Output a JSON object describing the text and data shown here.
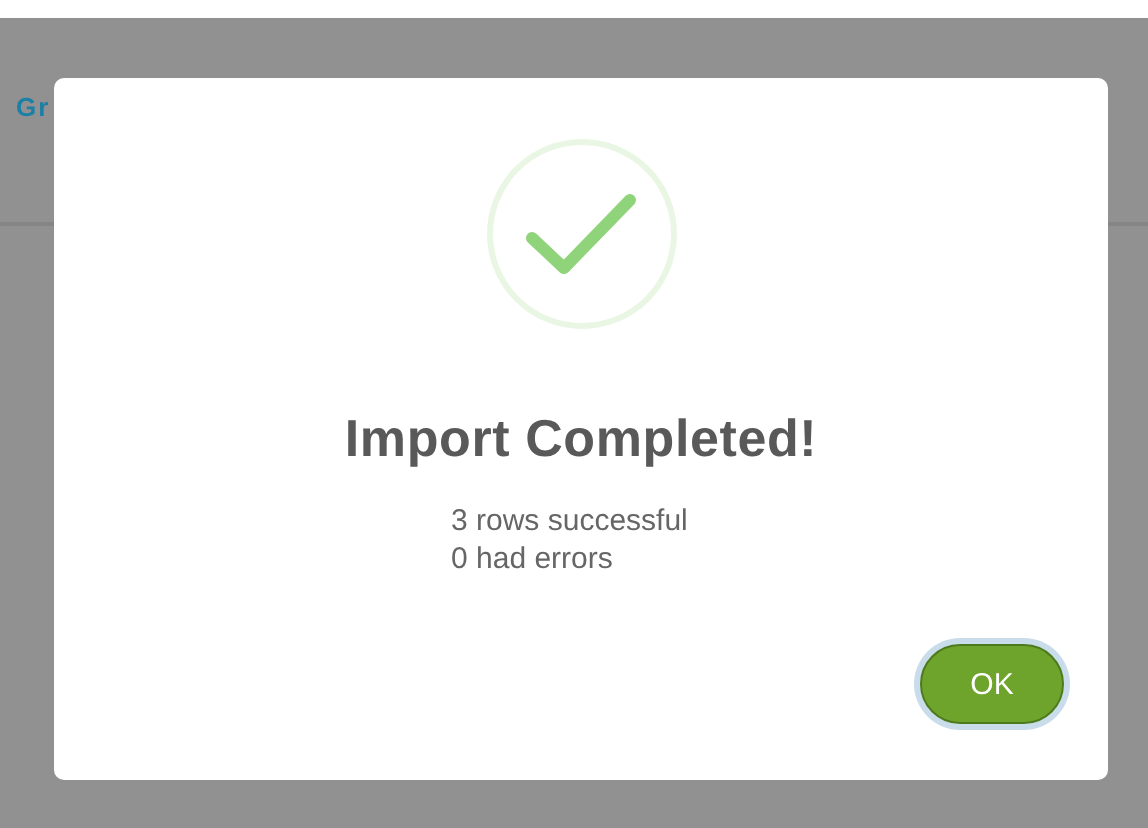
{
  "background": {
    "link_text": "Gr"
  },
  "dialog": {
    "title": "Import Completed!",
    "lines": [
      "3 rows successful",
      "0 had errors"
    ],
    "button": "OK"
  }
}
